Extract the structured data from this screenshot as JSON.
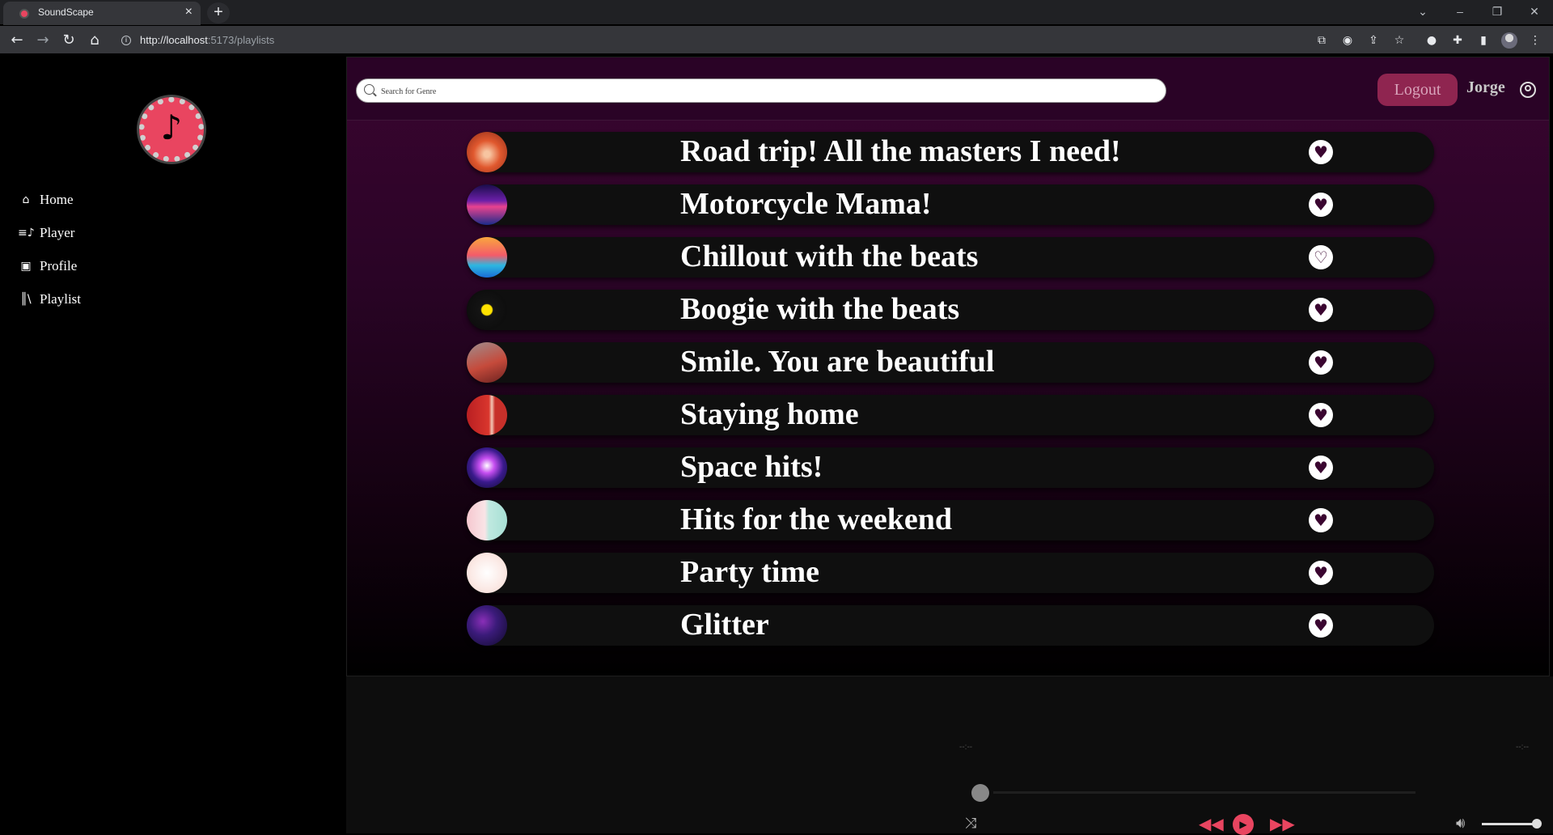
{
  "browser": {
    "tab_title": "SoundScape",
    "tab_close": "×",
    "new_tab": "+",
    "url_host": "http://localhost",
    "url_path": ":5173/playlists"
  },
  "sidebar": {
    "items": [
      {
        "label": "Home",
        "icon": "home-icon"
      },
      {
        "label": "Player",
        "icon": "player-icon"
      },
      {
        "label": "Profile",
        "icon": "profile-icon"
      },
      {
        "label": "Playlist",
        "icon": "playlist-icon"
      }
    ]
  },
  "header": {
    "search_placeholder": "Search for Genre",
    "logout_label": "Logout",
    "username": "Jorge"
  },
  "playlists": [
    {
      "title": "Road trip! All the masters I need!",
      "favorited": true
    },
    {
      "title": "Motorcycle Mama!",
      "favorited": true
    },
    {
      "title": "Chillout with the beats",
      "favorited": false
    },
    {
      "title": "Boogie with the beats",
      "favorited": true
    },
    {
      "title": "Smile. You are beautiful",
      "favorited": true
    },
    {
      "title": "Staying home",
      "favorited": true
    },
    {
      "title": "Space hits!",
      "favorited": true
    },
    {
      "title": "Hits for the weekend",
      "favorited": true
    },
    {
      "title": "Party time",
      "favorited": true
    },
    {
      "title": "Glitter",
      "favorited": true
    }
  ],
  "player": {
    "time_elapsed": "--:--",
    "time_total": "--:--",
    "progress_fraction": 0,
    "volume_fraction": 1
  },
  "colors": {
    "accent": "#e94560",
    "header_bg": "#2a0326",
    "logout_bg": "#8f2550"
  }
}
